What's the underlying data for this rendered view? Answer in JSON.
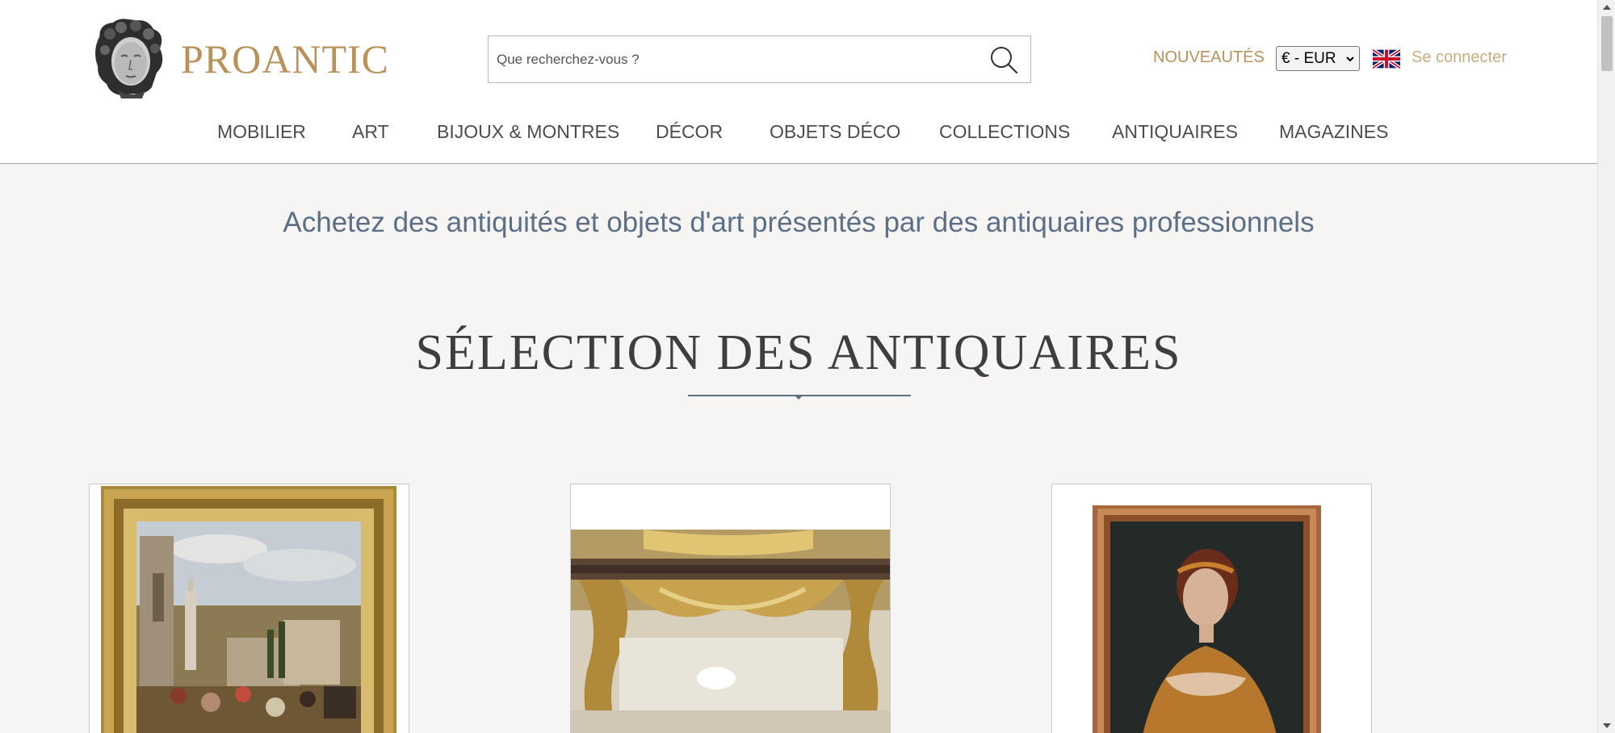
{
  "header": {
    "brand": "PROANTIC",
    "search_placeholder": "Que recherchez-vous ?",
    "nouveautes": "NOUVEAUTÉS",
    "currency": "€ - EUR",
    "login": "Se connecter"
  },
  "nav": [
    {
      "label": "MOBILIER"
    },
    {
      "label": "ART"
    },
    {
      "label": "BIJOUX & MONTRES"
    },
    {
      "label": "DÉCOR"
    },
    {
      "label": "OBJETS DÉCO"
    },
    {
      "label": "COLLECTIONS"
    },
    {
      "label": "ANTIQUAIRES"
    },
    {
      "label": "MAGAZINES"
    }
  ],
  "main": {
    "tagline": "Achetez des antiquités et objets d'art présentés par des antiquaires professionnels",
    "section_title": "SÉLECTION DES ANTIQUAIRES"
  },
  "cards": [
    {
      "subject": "landscape-painting"
    },
    {
      "subject": "gilded-console-table"
    },
    {
      "subject": "portrait-painting"
    }
  ],
  "colors": {
    "brand": "#b8925a",
    "accent": "#5b6f87",
    "login": "#c8ad7f",
    "background": "#f6f5f3"
  },
  "icons": [
    "search-icon",
    "uk-flag-icon",
    "chevron-down-icon",
    "logo-bust-icon"
  ]
}
